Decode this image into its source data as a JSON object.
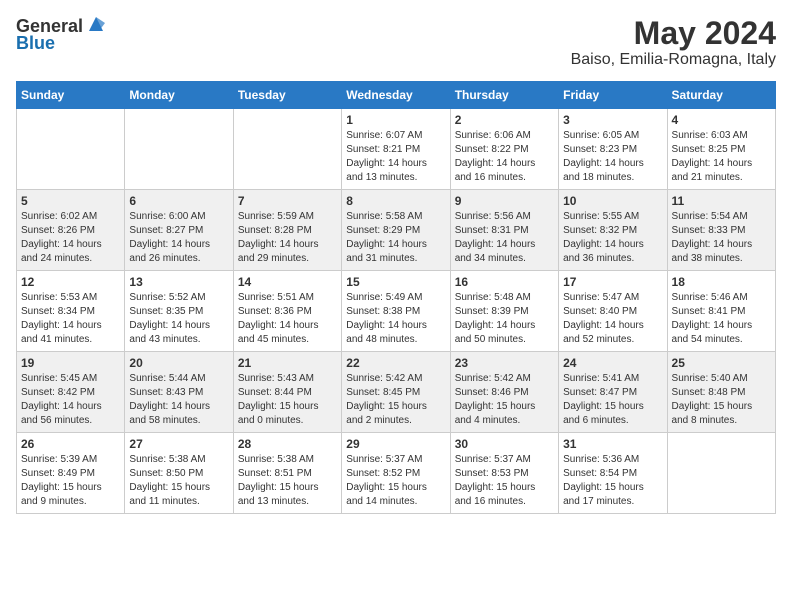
{
  "header": {
    "logo_general": "General",
    "logo_blue": "Blue",
    "title": "May 2024",
    "subtitle": "Baiso, Emilia-Romagna, Italy"
  },
  "days_of_week": [
    "Sunday",
    "Monday",
    "Tuesday",
    "Wednesday",
    "Thursday",
    "Friday",
    "Saturday"
  ],
  "weeks": [
    [
      {
        "day": "",
        "info": ""
      },
      {
        "day": "",
        "info": ""
      },
      {
        "day": "",
        "info": ""
      },
      {
        "day": "1",
        "info": "Sunrise: 6:07 AM\nSunset: 8:21 PM\nDaylight: 14 hours\nand 13 minutes."
      },
      {
        "day": "2",
        "info": "Sunrise: 6:06 AM\nSunset: 8:22 PM\nDaylight: 14 hours\nand 16 minutes."
      },
      {
        "day": "3",
        "info": "Sunrise: 6:05 AM\nSunset: 8:23 PM\nDaylight: 14 hours\nand 18 minutes."
      },
      {
        "day": "4",
        "info": "Sunrise: 6:03 AM\nSunset: 8:25 PM\nDaylight: 14 hours\nand 21 minutes."
      }
    ],
    [
      {
        "day": "5",
        "info": "Sunrise: 6:02 AM\nSunset: 8:26 PM\nDaylight: 14 hours\nand 24 minutes."
      },
      {
        "day": "6",
        "info": "Sunrise: 6:00 AM\nSunset: 8:27 PM\nDaylight: 14 hours\nand 26 minutes."
      },
      {
        "day": "7",
        "info": "Sunrise: 5:59 AM\nSunset: 8:28 PM\nDaylight: 14 hours\nand 29 minutes."
      },
      {
        "day": "8",
        "info": "Sunrise: 5:58 AM\nSunset: 8:29 PM\nDaylight: 14 hours\nand 31 minutes."
      },
      {
        "day": "9",
        "info": "Sunrise: 5:56 AM\nSunset: 8:31 PM\nDaylight: 14 hours\nand 34 minutes."
      },
      {
        "day": "10",
        "info": "Sunrise: 5:55 AM\nSunset: 8:32 PM\nDaylight: 14 hours\nand 36 minutes."
      },
      {
        "day": "11",
        "info": "Sunrise: 5:54 AM\nSunset: 8:33 PM\nDaylight: 14 hours\nand 38 minutes."
      }
    ],
    [
      {
        "day": "12",
        "info": "Sunrise: 5:53 AM\nSunset: 8:34 PM\nDaylight: 14 hours\nand 41 minutes."
      },
      {
        "day": "13",
        "info": "Sunrise: 5:52 AM\nSunset: 8:35 PM\nDaylight: 14 hours\nand 43 minutes."
      },
      {
        "day": "14",
        "info": "Sunrise: 5:51 AM\nSunset: 8:36 PM\nDaylight: 14 hours\nand 45 minutes."
      },
      {
        "day": "15",
        "info": "Sunrise: 5:49 AM\nSunset: 8:38 PM\nDaylight: 14 hours\nand 48 minutes."
      },
      {
        "day": "16",
        "info": "Sunrise: 5:48 AM\nSunset: 8:39 PM\nDaylight: 14 hours\nand 50 minutes."
      },
      {
        "day": "17",
        "info": "Sunrise: 5:47 AM\nSunset: 8:40 PM\nDaylight: 14 hours\nand 52 minutes."
      },
      {
        "day": "18",
        "info": "Sunrise: 5:46 AM\nSunset: 8:41 PM\nDaylight: 14 hours\nand 54 minutes."
      }
    ],
    [
      {
        "day": "19",
        "info": "Sunrise: 5:45 AM\nSunset: 8:42 PM\nDaylight: 14 hours\nand 56 minutes."
      },
      {
        "day": "20",
        "info": "Sunrise: 5:44 AM\nSunset: 8:43 PM\nDaylight: 14 hours\nand 58 minutes."
      },
      {
        "day": "21",
        "info": "Sunrise: 5:43 AM\nSunset: 8:44 PM\nDaylight: 15 hours\nand 0 minutes."
      },
      {
        "day": "22",
        "info": "Sunrise: 5:42 AM\nSunset: 8:45 PM\nDaylight: 15 hours\nand 2 minutes."
      },
      {
        "day": "23",
        "info": "Sunrise: 5:42 AM\nSunset: 8:46 PM\nDaylight: 15 hours\nand 4 minutes."
      },
      {
        "day": "24",
        "info": "Sunrise: 5:41 AM\nSunset: 8:47 PM\nDaylight: 15 hours\nand 6 minutes."
      },
      {
        "day": "25",
        "info": "Sunrise: 5:40 AM\nSunset: 8:48 PM\nDaylight: 15 hours\nand 8 minutes."
      }
    ],
    [
      {
        "day": "26",
        "info": "Sunrise: 5:39 AM\nSunset: 8:49 PM\nDaylight: 15 hours\nand 9 minutes."
      },
      {
        "day": "27",
        "info": "Sunrise: 5:38 AM\nSunset: 8:50 PM\nDaylight: 15 hours\nand 11 minutes."
      },
      {
        "day": "28",
        "info": "Sunrise: 5:38 AM\nSunset: 8:51 PM\nDaylight: 15 hours\nand 13 minutes."
      },
      {
        "day": "29",
        "info": "Sunrise: 5:37 AM\nSunset: 8:52 PM\nDaylight: 15 hours\nand 14 minutes."
      },
      {
        "day": "30",
        "info": "Sunrise: 5:37 AM\nSunset: 8:53 PM\nDaylight: 15 hours\nand 16 minutes."
      },
      {
        "day": "31",
        "info": "Sunrise: 5:36 AM\nSunset: 8:54 PM\nDaylight: 15 hours\nand 17 minutes."
      },
      {
        "day": "",
        "info": ""
      }
    ]
  ]
}
